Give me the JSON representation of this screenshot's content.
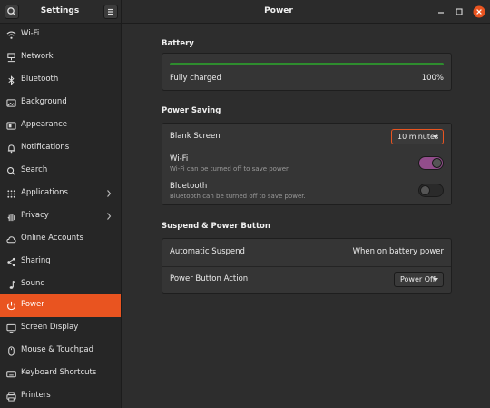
{
  "app": {
    "title": "Settings",
    "page_title": "Power"
  },
  "colors": {
    "accent": "#e95420",
    "toggle_on": "#924d8b",
    "progress": "#2e8c2e"
  },
  "sidebar": {
    "items": [
      {
        "label": "Wi-Fi",
        "icon": "wifi-icon"
      },
      {
        "label": "Network",
        "icon": "network-icon"
      },
      {
        "label": "Bluetooth",
        "icon": "bluetooth-icon"
      },
      {
        "label": "Background",
        "icon": "background-icon"
      },
      {
        "label": "Appearance",
        "icon": "appearance-icon"
      },
      {
        "label": "Notifications",
        "icon": "bell-icon"
      },
      {
        "label": "Search",
        "icon": "search-icon"
      },
      {
        "label": "Applications",
        "icon": "apps-grid-icon",
        "has_submenu": true
      },
      {
        "label": "Privacy",
        "icon": "hand-icon",
        "has_submenu": true
      },
      {
        "label": "Online Accounts",
        "icon": "cloud-icon"
      },
      {
        "label": "Sharing",
        "icon": "share-icon"
      },
      {
        "label": "Sound",
        "icon": "music-note-icon"
      },
      {
        "label": "Power",
        "icon": "power-icon",
        "active": true
      },
      {
        "label": "Screen Display",
        "icon": "display-icon"
      },
      {
        "label": "Mouse & Touchpad",
        "icon": "mouse-icon"
      },
      {
        "label": "Keyboard Shortcuts",
        "icon": "keyboard-icon"
      },
      {
        "label": "Printers",
        "icon": "printer-icon"
      }
    ]
  },
  "battery": {
    "title": "Battery",
    "status": "Fully charged",
    "percent_text": "100%",
    "level": 1.0
  },
  "power_saving": {
    "title": "Power Saving",
    "blank_screen": {
      "label": "Blank Screen",
      "value": "10 minutes"
    },
    "wifi": {
      "label": "Wi-Fi",
      "sub": "Wi-Fi can be turned off to save power.",
      "enabled": true
    },
    "bluetooth": {
      "label": "Bluetooth",
      "sub": "Bluetooth can be turned off to save power.",
      "enabled": false
    }
  },
  "suspend": {
    "title": "Suspend & Power Button",
    "automatic_suspend": {
      "label": "Automatic Suspend",
      "value": "When on battery power"
    },
    "power_button": {
      "label": "Power Button Action",
      "value": "Power Off"
    }
  }
}
